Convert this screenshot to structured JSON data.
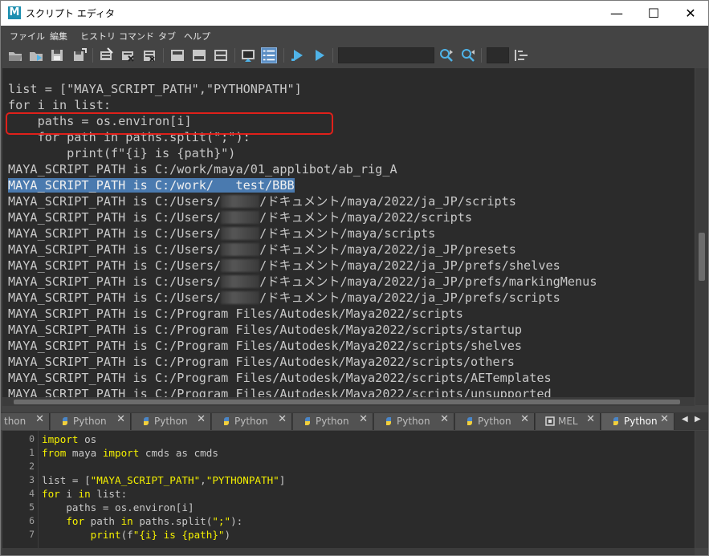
{
  "window": {
    "title": "スクリプト エディタ",
    "app_icon_letter": "M",
    "controls": {
      "minimize": "—",
      "maximize": "☐",
      "close": "✕"
    }
  },
  "menubar": {
    "items": [
      {
        "label": "ファイル"
      },
      {
        "label": "編集"
      },
      {
        "label": "ヒストリ"
      },
      {
        "label": "コマンド"
      },
      {
        "label": "タブ"
      },
      {
        "label": "ヘルプ"
      }
    ]
  },
  "toolbar": {
    "icons": [
      "open-script-icon",
      "source-script-icon",
      "save-script-icon",
      "save-script-to-shelf-icon",
      "clear-history-icon",
      "clear-input-icon",
      "clear-all-icon",
      "show-history-icon",
      "show-input-icon",
      "show-both-icon",
      "echo-all-commands-icon",
      "show-line-numbers-icon",
      "execute-all-icon",
      "execute-icon",
      "search-next-icon",
      "search-previous-icon",
      "go-to-line-icon"
    ],
    "search_value": "",
    "line_value": ""
  },
  "output": {
    "lines": [
      {
        "pre": "list = [\"MAYA_SCRIPT_PATH\",\"PYTHONPATH\"]",
        "post": ""
      },
      {
        "pre": "for i in list:",
        "post": ""
      },
      {
        "pre": "    paths = os.environ[i]",
        "post": ""
      },
      {
        "pre": "    for path in paths.split(\";\"):",
        "post": ""
      },
      {
        "pre": "        print(f\"{i} is {path}\")",
        "post": ""
      },
      {
        "pre": "MAYA_SCRIPT_PATH is C:/work/maya/01_applibot/ab_rig_A",
        "post": ""
      },
      {
        "pre": "MAYA_SCRIPT_PATH is C:/work/",
        "post": "test/BBB",
        "selected": true
      },
      {
        "pre": "MAYA_SCRIPT_PATH is C:/Users/",
        "post": "/ドキュメント/maya/2022/ja_JP/scripts"
      },
      {
        "pre": "MAYA_SCRIPT_PATH is C:/Users/",
        "post": "/ドキュメント/maya/2022/scripts"
      },
      {
        "pre": "MAYA_SCRIPT_PATH is C:/Users/",
        "post": "/ドキュメント/maya/scripts"
      },
      {
        "pre": "MAYA_SCRIPT_PATH is C:/Users/",
        "post": "/ドキュメント/maya/2022/ja_JP/presets"
      },
      {
        "pre": "MAYA_SCRIPT_PATH is C:/Users/",
        "post": "/ドキュメント/maya/2022/ja_JP/prefs/shelves"
      },
      {
        "pre": "MAYA_SCRIPT_PATH is C:/Users/",
        "post": "/ドキュメント/maya/2022/ja_JP/prefs/markingMenus"
      },
      {
        "pre": "MAYA_SCRIPT_PATH is C:/Users/",
        "post": "/ドキュメント/maya/2022/ja_JP/prefs/scripts"
      },
      {
        "pre": "MAYA_SCRIPT_PATH is C:/Program Files/Autodesk/Maya2022/scripts",
        "post": ""
      },
      {
        "pre": "MAYA_SCRIPT_PATH is C:/Program Files/Autodesk/Maya2022/scripts/startup",
        "post": ""
      },
      {
        "pre": "MAYA_SCRIPT_PATH is C:/Program Files/Autodesk/Maya2022/scripts/shelves",
        "post": ""
      },
      {
        "pre": "MAYA_SCRIPT_PATH is C:/Program Files/Autodesk/Maya2022/scripts/others",
        "post": ""
      },
      {
        "pre": "MAYA_SCRIPT_PATH is C:/Program Files/Autodesk/Maya2022/scripts/AETemplates",
        "post": ""
      },
      {
        "pre": "MAYA_SCRIPT_PATH is C:/Program Files/Autodesk/Maya2022/scripts/unsupported",
        "post": ""
      }
    ]
  },
  "tabs": [
    {
      "label": "thon",
      "type": "python"
    },
    {
      "label": "Python",
      "type": "python"
    },
    {
      "label": "Python",
      "type": "python"
    },
    {
      "label": "Python",
      "type": "python"
    },
    {
      "label": "Python",
      "type": "python"
    },
    {
      "label": "Python",
      "type": "python"
    },
    {
      "label": "Python",
      "type": "python"
    },
    {
      "label": "MEL",
      "type": "mel"
    },
    {
      "label": "Python",
      "type": "python",
      "active": true
    }
  ],
  "tab_close": "✕",
  "tab_scroll": {
    "left": "◀",
    "right": "▶"
  },
  "editor": {
    "line_numbers": [
      "0",
      "1",
      "2",
      "3",
      "4",
      "5",
      "6",
      "7"
    ],
    "lines": [
      [
        {
          "t": "import",
          "c": "kw"
        },
        {
          "t": " os",
          "c": ""
        }
      ],
      [
        {
          "t": "from",
          "c": "kw"
        },
        {
          "t": " maya ",
          "c": ""
        },
        {
          "t": "import",
          "c": "kw"
        },
        {
          "t": " cmds as cmds",
          "c": ""
        }
      ],
      [],
      [
        {
          "t": "list = [",
          "c": ""
        },
        {
          "t": "\"MAYA_SCRIPT_PATH\"",
          "c": "str"
        },
        {
          "t": ",",
          "c": ""
        },
        {
          "t": "\"PYTHONPATH\"",
          "c": "str"
        },
        {
          "t": "]",
          "c": ""
        }
      ],
      [
        {
          "t": "for",
          "c": "kw"
        },
        {
          "t": " i ",
          "c": ""
        },
        {
          "t": "in",
          "c": "kw"
        },
        {
          "t": " list:",
          "c": ""
        }
      ],
      [
        {
          "t": "    paths = os.environ[i]",
          "c": ""
        }
      ],
      [
        {
          "t": "    ",
          "c": ""
        },
        {
          "t": "for",
          "c": "kw"
        },
        {
          "t": " path ",
          "c": ""
        },
        {
          "t": "in",
          "c": "kw"
        },
        {
          "t": " paths.split(",
          "c": ""
        },
        {
          "t": "\";\"",
          "c": "str"
        },
        {
          "t": "):",
          "c": ""
        }
      ],
      [
        {
          "t": "        ",
          "c": ""
        },
        {
          "t": "print",
          "c": "kw"
        },
        {
          "t": "(f",
          "c": ""
        },
        {
          "t": "\"{i} is {path}\"",
          "c": "str"
        },
        {
          "t": ")",
          "c": ""
        }
      ]
    ]
  },
  "colors": {
    "background": "#444444",
    "output_bg": "#2b2b2b",
    "selection": "#4a7aaf",
    "highlight_box": "#e0201a",
    "keyword": "#f4f000"
  }
}
